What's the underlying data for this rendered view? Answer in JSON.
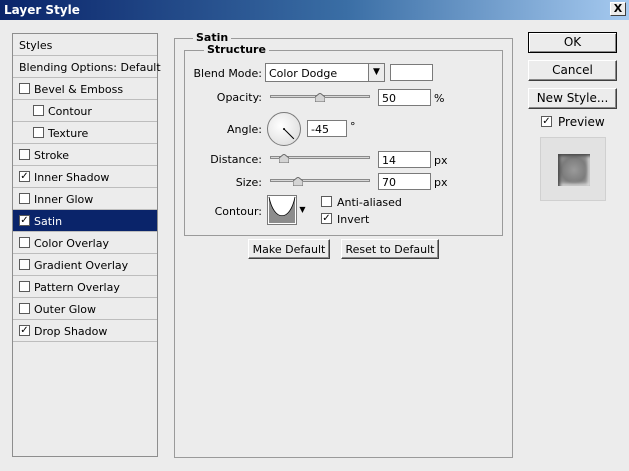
{
  "window": {
    "title": "Layer Style",
    "close_label": "X"
  },
  "style_list": {
    "header": "Styles",
    "blending_options": "Blending Options: Default",
    "items": [
      {
        "label": "Bevel & Emboss",
        "checked": false,
        "indent": false
      },
      {
        "label": "Contour",
        "checked": false,
        "indent": true
      },
      {
        "label": "Texture",
        "checked": false,
        "indent": true
      },
      {
        "label": "Stroke",
        "checked": false,
        "indent": false
      },
      {
        "label": "Inner Shadow",
        "checked": true,
        "indent": false
      },
      {
        "label": "Inner Glow",
        "checked": false,
        "indent": false
      },
      {
        "label": "Satin",
        "checked": true,
        "indent": false,
        "selected": true
      },
      {
        "label": "Color Overlay",
        "checked": false,
        "indent": false
      },
      {
        "label": "Gradient Overlay",
        "checked": false,
        "indent": false
      },
      {
        "label": "Pattern Overlay",
        "checked": false,
        "indent": false
      },
      {
        "label": "Outer Glow",
        "checked": false,
        "indent": false
      },
      {
        "label": "Drop Shadow",
        "checked": true,
        "indent": false
      }
    ]
  },
  "satin": {
    "section_title": "Satin",
    "structure_title": "Structure",
    "blend_mode_label": "Blend Mode:",
    "blend_mode_value": "Color Dodge",
    "blend_color": "#ffffff",
    "opacity_label": "Opacity:",
    "opacity_value": "50",
    "opacity_unit": "%",
    "opacity_fraction": 0.5,
    "angle_label": "Angle:",
    "angle_value": "-45",
    "angle_unit": "°",
    "angle_degrees": -45,
    "distance_label": "Distance:",
    "distance_value": "14",
    "distance_unit": "px",
    "distance_fraction": 0.14,
    "size_label": "Size:",
    "size_value": "70",
    "size_unit": "px",
    "size_fraction": 0.28,
    "contour_label": "Contour:",
    "anti_aliased_label": "Anti-aliased",
    "anti_aliased_checked": false,
    "invert_label": "Invert",
    "invert_checked": true,
    "make_default_label": "Make Default",
    "reset_default_label": "Reset to Default"
  },
  "buttons": {
    "ok": "OK",
    "cancel": "Cancel",
    "new_style": "New Style..."
  },
  "preview": {
    "label": "Preview",
    "checked": true
  },
  "check_glyph": "✓",
  "colors": {
    "selected_row": "#0a246a",
    "title_start": "#0a246a",
    "title_end": "#a6caf0"
  }
}
